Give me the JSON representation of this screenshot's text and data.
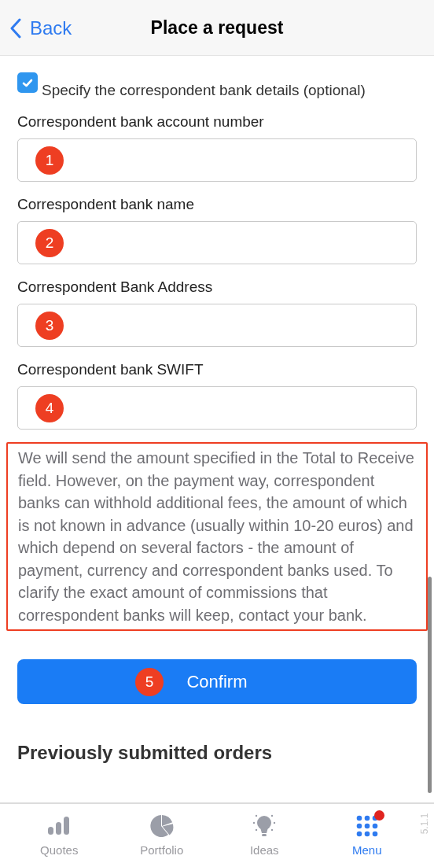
{
  "header": {
    "back": "Back",
    "title": "Place a request"
  },
  "checkbox": {
    "label": "Specify the correspondent bank details (optional)",
    "checked": true
  },
  "fields": [
    {
      "label": "Correspondent bank account number",
      "marker": "1"
    },
    {
      "label": "Correspondent bank name",
      "marker": "2"
    },
    {
      "label": "Correspondent Bank Address",
      "marker": "3"
    },
    {
      "label": "Correspondent bank SWIFT",
      "marker": "4"
    }
  ],
  "note": {
    "text": "We will send the amount specified in the Total to Receive field. However, on the payment way, correspondent banks can withhold additional fees, the amount of which is not known in advance (usually within 10-20 euros) and which depend on several factors - the amount of payment, currency and correspondent banks used. To clarify the exact amount of commissions that correspondent banks will keep, contact your bank.",
    "highlighted": true
  },
  "confirm": {
    "label": "Confirm",
    "marker": "5"
  },
  "section_title": "Previously submitted orders",
  "tabs": [
    {
      "label": "Quotes",
      "kind": "bars",
      "selected": false,
      "badge": false
    },
    {
      "label": "Portfolio",
      "kind": "pie",
      "selected": false,
      "badge": false
    },
    {
      "label": "Ideas",
      "kind": "bulb",
      "selected": false,
      "badge": false
    },
    {
      "label": "Menu",
      "kind": "dots",
      "selected": true,
      "badge": true
    }
  ],
  "version": "5.1.1"
}
